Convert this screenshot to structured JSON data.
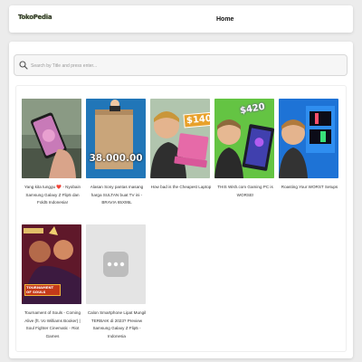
{
  "header": {
    "logo_text": "TokoPedia",
    "nav_home": "Home"
  },
  "search": {
    "placeholder": "Search by Title and press enter...",
    "value": ""
  },
  "videos": [
    {
      "title": "Yang kita tunggu ❤️ - Nyobain Samsung Galaxy Z Flip5 dan Fold5 Indonesia!",
      "icon": "phone-hand-thumbnail"
    },
    {
      "title": "Alasan Sony pantas masang harga SULTAN buat TV ini - BRAVIA 65X95L",
      "icon": "sony-tv-box-thumbnail",
      "overlay": "38.000.00"
    },
    {
      "title": "How bad is the Cheapest Laptop",
      "icon": "laptop-price-thumbnail",
      "overlay": "$140"
    },
    {
      "title": "THIS Wish.com Gaming PC is WORSE!",
      "icon": "gaming-pc-thumbnail",
      "overlay": "$420"
    },
    {
      "title": "Roasting Your WORST Setups",
      "icon": "setup-thumbnail"
    },
    {
      "title": "Tournament of Souls - Coming Alive (ft. Vo Williams Booker) | Soul Fighter Cinematic - Riot Games",
      "icon": "tournament-poster-thumbnail",
      "overlay": "TOURNAMENT OF SOULS"
    },
    {
      "title": "Calon Smartphone Lipat Mungil TERBAIK di 2023? Preview Samsung Galaxy Z Flip5 - Indonesia",
      "icon": "placeholder-thumbnail"
    }
  ]
}
